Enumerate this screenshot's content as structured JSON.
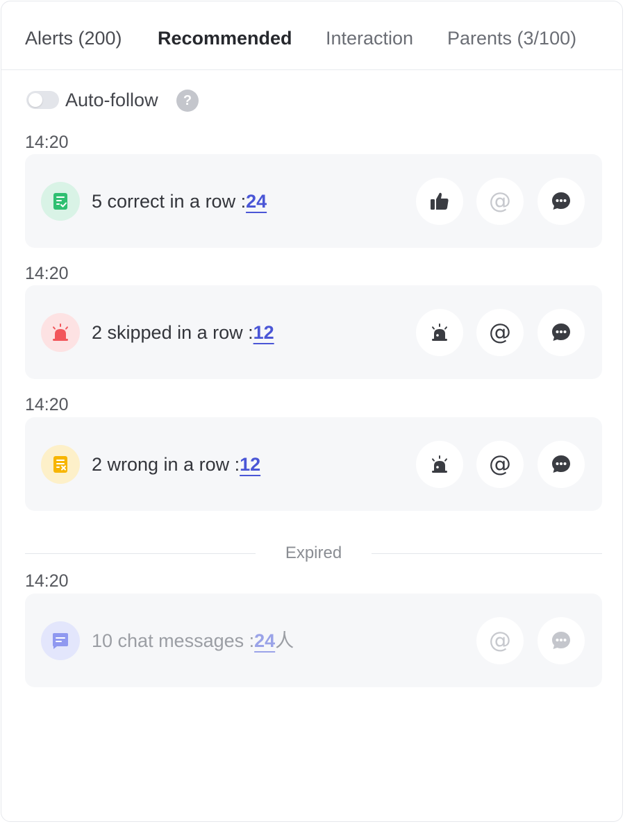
{
  "tabs": [
    {
      "label": "Alerts (200)"
    },
    {
      "label": "Recommended"
    },
    {
      "label": "Interaction"
    },
    {
      "label": "Parents (3/100)"
    }
  ],
  "active_tab": "Recommended",
  "auto_follow": {
    "label": "Auto-follow",
    "enabled": false,
    "help": "?"
  },
  "cards": [
    {
      "time": "14:20",
      "text": "5 correct in a row :",
      "count": "24",
      "suffix": "",
      "icon": "checklist-icon",
      "icon_color": "#2fbf71",
      "icon_bg": "#d9f3e6",
      "actions": [
        "thumbs-up-icon",
        "at-icon",
        "chat-icon"
      ]
    },
    {
      "time": "14:20",
      "text": "2 skipped in a row :",
      "count": "12",
      "suffix": "",
      "icon": "alarm-icon",
      "icon_color": "#f2565b",
      "icon_bg": "#fde2e3",
      "actions": [
        "alarm-icon",
        "at-icon",
        "chat-icon"
      ]
    },
    {
      "time": "14:20",
      "text": "2 wrong in a row :",
      "count": "12",
      "suffix": "",
      "icon": "wrong-list-icon",
      "icon_color": "#f7b500",
      "icon_bg": "#fdf0c9",
      "actions": [
        "alarm-icon",
        "at-icon",
        "chat-icon"
      ]
    }
  ],
  "expired_label": "Expired",
  "expired_cards": [
    {
      "time": "14:20",
      "text": "10 chat messages :",
      "count": "24",
      "suffix": "人",
      "icon": "message-icon",
      "icon_color": "#8f98f0",
      "icon_bg": "#e3e6fc",
      "actions": [
        "at-icon",
        "chat-icon"
      ]
    }
  ]
}
